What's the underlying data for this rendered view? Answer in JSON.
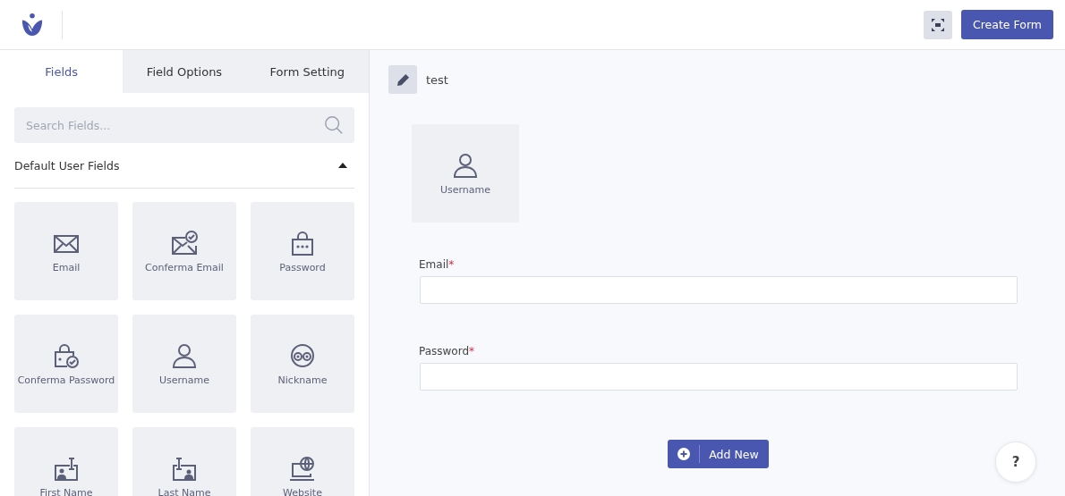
{
  "header": {
    "create_button": "Create Form"
  },
  "tabs": [
    {
      "label": "Fields",
      "selected": true
    },
    {
      "label": "Field Options",
      "selected": false
    },
    {
      "label": "Form Setting",
      "selected": false
    }
  ],
  "search": {
    "placeholder": "Search Fields..."
  },
  "section": {
    "title": "Default User Fields",
    "expanded": true
  },
  "field_tiles": [
    {
      "label": "Email",
      "kind": "email"
    },
    {
      "label": "Conferma Email",
      "kind": "email-check"
    },
    {
      "label": "Password",
      "kind": "password"
    },
    {
      "label": "Conferma Password",
      "kind": "password-check"
    },
    {
      "label": "Username",
      "kind": "user"
    },
    {
      "label": "Nickname",
      "kind": "nickname"
    },
    {
      "label": "First Name",
      "kind": "first-name"
    },
    {
      "label": "Last Name",
      "kind": "last-name"
    },
    {
      "label": "Website",
      "kind": "website"
    }
  ],
  "form": {
    "title": "test",
    "placed_tile": {
      "label": "Username",
      "kind": "user"
    },
    "fields": [
      {
        "label": "Email",
        "required_mark": "*"
      },
      {
        "label": "Password",
        "required_mark": "*"
      }
    ],
    "add_button": "Add New"
  },
  "help_button": "?"
}
